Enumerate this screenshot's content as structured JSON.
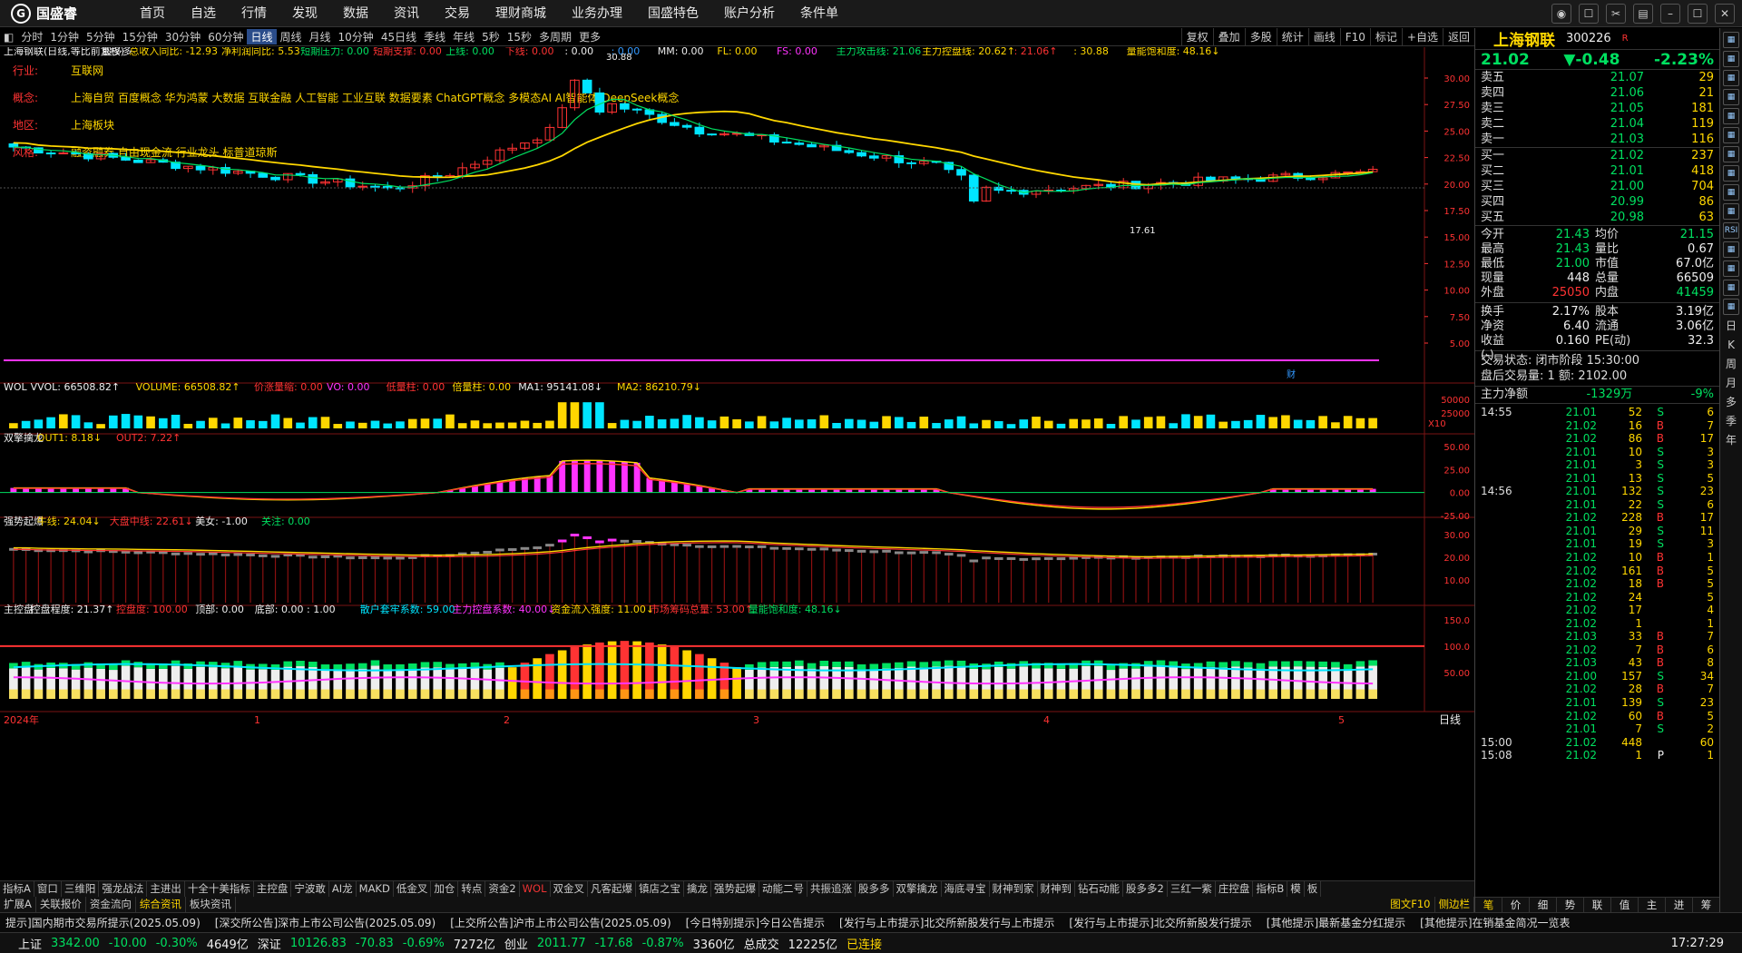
{
  "app": {
    "brand": "国盛睿",
    "menu": [
      "首页",
      "自选",
      "行情",
      "发现",
      "数据",
      "资讯",
      "交易",
      "理财商城",
      "业务办理",
      "国盛特色",
      "账户分析",
      "条件单"
    ]
  },
  "periods": [
    "分时",
    "1分钟",
    "5分钟",
    "15分钟",
    "30分钟",
    "60分钟",
    "日线",
    "周线",
    "月线",
    "10分钟",
    "45日线",
    "季线",
    "年线",
    "5秒",
    "15秒",
    "多周期",
    "更多"
  ],
  "active_period": "日线",
  "tools": [
    "复权",
    "叠加",
    "多股",
    "统计",
    "画线",
    "F10",
    "标记",
    "+自选",
    "返回"
  ],
  "chart": {
    "header": [
      {
        "t": "上海钢联(日线,等比前复权)",
        "c": "#eeeeee"
      },
      {
        "t": "股多多",
        "c": "#eeeeee"
      },
      {
        "t": "总收入同比: -12.93",
        "c": "#ffd700"
      },
      {
        "t": "净利润同比: 5.53",
        "c": "#ffd700"
      },
      {
        "t": "短期压力: 0.00",
        "c": "#00e060"
      },
      {
        "t": "短期支撑: 0.00",
        "c": "#ff3333"
      },
      {
        "t": "上线: 0.00",
        "c": "#00e060"
      },
      {
        "t": "下线: 0.00",
        "c": "#ff3333"
      },
      {
        "t": ": 0.00",
        "c": "#eeeeee"
      },
      {
        "t": ": 0.00",
        "c": "#3399ff"
      },
      {
        "t": "MM: 0.00",
        "c": "#eeeeee"
      },
      {
        "t": "FL: 0.00",
        "c": "#ffd700"
      },
      {
        "t": "FS: 0.00",
        "c": "#ff33ff"
      },
      {
        "t": "主力攻击线: 21.06",
        "c": "#00e060"
      },
      {
        "t": "主力控盘线: 20.62↑",
        "c": "#ffd700"
      },
      {
        "t": ": 21.06↑",
        "c": "#ff3333"
      },
      {
        "t": ": 30.88",
        "c": "#ffd700"
      },
      {
        "t": "量能饱和度: 48.16↓",
        "c": "#ffd700"
      }
    ],
    "info": [
      {
        "label": "行业:",
        "value": "互联网"
      },
      {
        "label": "概念:",
        "value": "上海自贸 百度概念 华为鸿蒙 大数据 互联金融 人工智能 工业互联 数据要素 ChatGPT概念 多模态AI AI智能体 DeepSeek概念"
      },
      {
        "label": "地区:",
        "value": "上海板块"
      },
      {
        "label": "风格:",
        "value": "融资融券 自由现金流 行业龙头 标普道琼斯"
      }
    ],
    "price_labels": [
      "30.00",
      "27.50",
      "25.00",
      "22.50",
      "20.00",
      "17.50",
      "15.00",
      "12.50",
      "10.00",
      "7.50",
      "5.00"
    ],
    "high_mark": "30.88",
    "low_mark": "17.61",
    "tag_cai": "财",
    "axis_unit": "X10",
    "vol_header": [
      {
        "t": "WOL",
        "c": "#eeeeee"
      },
      {
        "t": "VVOL: 66508.82↑",
        "c": "#eeeeee"
      },
      {
        "t": "VOLUME: 66508.82↑",
        "c": "#ffd700"
      },
      {
        "t": "价涨量缩: 0.00",
        "c": "#ff3333"
      },
      {
        "t": "VO: 0.00",
        "c": "#ff33ff"
      },
      {
        "t": "低量柱: 0.00",
        "c": "#ff3333"
      },
      {
        "t": "倍量柱: 0.00",
        "c": "#ffd700"
      },
      {
        "t": "MA1: 95141.08↓",
        "c": "#eeeeee"
      },
      {
        "t": "MA2: 86210.79↓",
        "c": "#ffd700"
      }
    ],
    "vol_labels": [
      "50000",
      "25000"
    ],
    "dl_header": [
      {
        "t": "双擎擒龙",
        "c": "#eeeeee"
      },
      {
        "t": "OUT1: 8.18↓",
        "c": "#ffd700"
      },
      {
        "t": "OUT2: 7.22↑",
        "c": "#ff3333"
      }
    ],
    "dl_labels": [
      "50.00",
      "25.00",
      "0.00",
      "-25.00"
    ],
    "qs_header": [
      {
        "t": "强势起爆",
        "c": "#eeeeee"
      },
      {
        "t": "牛线: 24.04↓",
        "c": "#ffd700"
      },
      {
        "t": "大盘中线: 22.61↓",
        "c": "#ff3333"
      },
      {
        "t": "美女: -1.00",
        "c": "#eeeeee"
      },
      {
        "t": "关注: 0.00",
        "c": "#00e060"
      }
    ],
    "qs_labels": [
      "30.00",
      "20.00",
      "10.00"
    ],
    "zk_header": [
      {
        "t": "主控盘",
        "c": "#eeeeee"
      },
      {
        "t": "控盘程度: 21.37↑",
        "c": "#eeeeee"
      },
      {
        "t": "控盘度: 100.00",
        "c": "#ff3333"
      },
      {
        "t": "顶部: 0.00",
        "c": "#eeeeee"
      },
      {
        "t": "底部: 0.00 : 1.00",
        "c": "#eeeeee"
      },
      {
        "t": "散户套牢系数: 59.00",
        "c": "#00e5ff"
      },
      {
        "t": "主力控盘系数: 40.00↓",
        "c": "#ff33ff"
      },
      {
        "t": "资金流入强度: 11.00↓",
        "c": "#ffd700"
      },
      {
        "t": "市场筹码总量: 53.00↑",
        "c": "#ff3333"
      },
      {
        "t": "量能饱和度: 48.16↓",
        "c": "#00e060"
      }
    ],
    "zk_labels": [
      "150.0",
      "100.0",
      "50.00"
    ],
    "months": [
      "2024年",
      "1",
      "2",
      "3",
      "4",
      "5"
    ],
    "daily_label": "日线"
  },
  "bottom_tabs": [
    "指标A",
    "窗口",
    "三维阳",
    "强龙战法",
    "主进出",
    "十全十美指标",
    "主控盘",
    "宁波敢",
    "AI龙",
    "MAKD",
    "低金叉",
    "加仓",
    "转点",
    "资金2",
    "WOL",
    "双金叉",
    "凡客起爆",
    "镇店之宝",
    "擒龙",
    "强势起爆",
    "动能二号",
    "共振追涨",
    "股多多",
    "双擎擒龙",
    "海底寻宝",
    "财神到家",
    "财神到",
    "钻石动能",
    "股多多2",
    "三红一紫",
    "庄控盘",
    "指标B",
    "模",
    "板"
  ],
  "active_tab": "WOL",
  "bottom_tabs2": [
    "扩展A",
    "关联报价",
    "资金流向",
    "综合资讯",
    "板块资讯"
  ],
  "active_tab2": "综合资讯",
  "side_tabs": [
    "图文F10",
    "侧边栏"
  ],
  "news": [
    "提示]国内期市交易所提示(2025.05.09)",
    "[深交所公告]深市上市公司公告(2025.05.09)",
    "[上交所公告]沪市上市公司公告(2025.05.09)",
    "[今日特别提示]今日公告提示",
    "[发行与上市提示]北交所新股发行与上市提示",
    "[发行与上市提示]北交所新股发行提示",
    "[其他提示]最新基金分红提示",
    "[其他提示]在销基金简况一览表"
  ],
  "status": {
    "sh_label": "上证",
    "sh": "3342.00",
    "sh_chg": "-10.00",
    "sh_pct": "-0.30%",
    "sh_amt": "4649亿",
    "sz_label": "深证",
    "sz": "10126.83",
    "sz_chg": "-70.83",
    "sz_pct": "-0.69%",
    "sz_amt": "7272亿",
    "cy_label": "创业",
    "cy": "2011.77",
    "cy_chg": "-17.68",
    "cy_pct": "-0.87%",
    "cy_amt": "3360亿",
    "total_label": "总成交",
    "total": "12225亿",
    "conn": "已连接",
    "time": "17:27:29"
  },
  "quote": {
    "name": "上海钢联",
    "code": "300226",
    "flag": "R",
    "price": "21.02",
    "change": "▼-0.48",
    "pct": "-2.23%",
    "asks": [
      {
        "l": "卖五",
        "p": "21.07",
        "v": "29"
      },
      {
        "l": "卖四",
        "p": "21.06",
        "v": "21"
      },
      {
        "l": "卖三",
        "p": "21.05",
        "v": "181"
      },
      {
        "l": "卖二",
        "p": "21.04",
        "v": "119"
      },
      {
        "l": "卖一",
        "p": "21.03",
        "v": "116"
      }
    ],
    "bids": [
      {
        "l": "买一",
        "p": "21.02",
        "v": "237"
      },
      {
        "l": "买二",
        "p": "21.01",
        "v": "418"
      },
      {
        "l": "买三",
        "p": "21.00",
        "v": "704"
      },
      {
        "l": "买四",
        "p": "20.99",
        "v": "86"
      },
      {
        "l": "买五",
        "p": "20.98",
        "v": "63"
      }
    ],
    "stats": [
      {
        "l": "今开",
        "v": "21.43",
        "l2": "均价",
        "v2": "21.15"
      },
      {
        "l": "最高",
        "v": "21.43",
        "l2": "量比",
        "v2": "0.67"
      },
      {
        "l": "最低",
        "v": "21.00",
        "l2": "市值",
        "v2": "67.0亿"
      },
      {
        "l": "现量",
        "v": "448",
        "l2": "总量",
        "v2": "66509"
      },
      {
        "l": "外盘",
        "v": "25050",
        "l2": "内盘",
        "v2": "41459"
      }
    ],
    "stats2": [
      {
        "l": "换手",
        "v": "2.17%",
        "l2": "股本",
        "v2": "3.19亿"
      },
      {
        "l": "净资",
        "v": "6.40",
        "l2": "流通",
        "v2": "3.06亿"
      },
      {
        "l": "收益(-)",
        "v": "0.160",
        "l2": "PE(动)",
        "v2": "32.3"
      }
    ],
    "trade_state": "交易状态: 闭市阶段 15:30:00",
    "after_hours": "盘后交易量: 1  额: 2102.00",
    "flow_label": "主力净额",
    "flow_value": "-1329万",
    "flow_pct": "-9%",
    "ticks": [
      {
        "t": "14:55",
        "p": "21.01",
        "v": "52",
        "s": "S",
        "n": "6"
      },
      {
        "t": "",
        "p": "21.02",
        "v": "16",
        "s": "B",
        "n": "7"
      },
      {
        "t": "",
        "p": "21.02",
        "v": "86",
        "s": "B",
        "n": "17"
      },
      {
        "t": "",
        "p": "21.01",
        "v": "10",
        "s": "S",
        "n": "3"
      },
      {
        "t": "",
        "p": "21.01",
        "v": "3",
        "s": "S",
        "n": "3"
      },
      {
        "t": "",
        "p": "21.01",
        "v": "13",
        "s": "S",
        "n": "5"
      },
      {
        "t": "14:56",
        "p": "21.01",
        "v": "132",
        "s": "S",
        "n": "23"
      },
      {
        "t": "",
        "p": "21.01",
        "v": "22",
        "s": "S",
        "n": "6"
      },
      {
        "t": "",
        "p": "21.02",
        "v": "228",
        "s": "B",
        "n": "17"
      },
      {
        "t": "",
        "p": "21.01",
        "v": "29",
        "s": "S",
        "n": "11"
      },
      {
        "t": "",
        "p": "21.01",
        "v": "19",
        "s": "S",
        "n": "3"
      },
      {
        "t": "",
        "p": "21.02",
        "v": "10",
        "s": "B",
        "n": "1"
      },
      {
        "t": "",
        "p": "21.02",
        "v": "161",
        "s": "B",
        "n": "5"
      },
      {
        "t": "",
        "p": "21.02",
        "v": "18",
        "s": "B",
        "n": "5"
      },
      {
        "t": "",
        "p": "21.02",
        "v": "24",
        "s": "",
        "n": "5"
      },
      {
        "t": "",
        "p": "21.02",
        "v": "17",
        "s": "",
        "n": "4"
      },
      {
        "t": "",
        "p": "21.02",
        "v": "1",
        "s": "",
        "n": "1"
      },
      {
        "t": "",
        "p": "21.03",
        "v": "33",
        "s": "B",
        "n": "7"
      },
      {
        "t": "",
        "p": "21.02",
        "v": "7",
        "s": "B",
        "n": "6"
      },
      {
        "t": "",
        "p": "21.03",
        "v": "43",
        "s": "B",
        "n": "8"
      },
      {
        "t": "",
        "p": "21.00",
        "v": "157",
        "s": "S",
        "n": "34"
      },
      {
        "t": "",
        "p": "21.02",
        "v": "28",
        "s": "B",
        "n": "7"
      },
      {
        "t": "",
        "p": "21.01",
        "v": "139",
        "s": "S",
        "n": "23"
      },
      {
        "t": "",
        "p": "21.02",
        "v": "60",
        "s": "B",
        "n": "5"
      },
      {
        "t": "",
        "p": "21.01",
        "v": "7",
        "s": "S",
        "n": "2"
      },
      {
        "t": "15:00",
        "p": "21.02",
        "v": "448",
        "s": "",
        "n": "60"
      },
      {
        "t": "15:08",
        "p": "21.02",
        "v": "1",
        "s": "P",
        "n": "1"
      }
    ],
    "tabs": [
      "笔",
      "价",
      "细",
      "势",
      "联",
      "值",
      "主",
      "进",
      "筹"
    ]
  },
  "side_chars": [
    "日",
    "K",
    "周",
    "月",
    "多",
    "季",
    "年"
  ],
  "side_icons": [
    "RSI"
  ]
}
